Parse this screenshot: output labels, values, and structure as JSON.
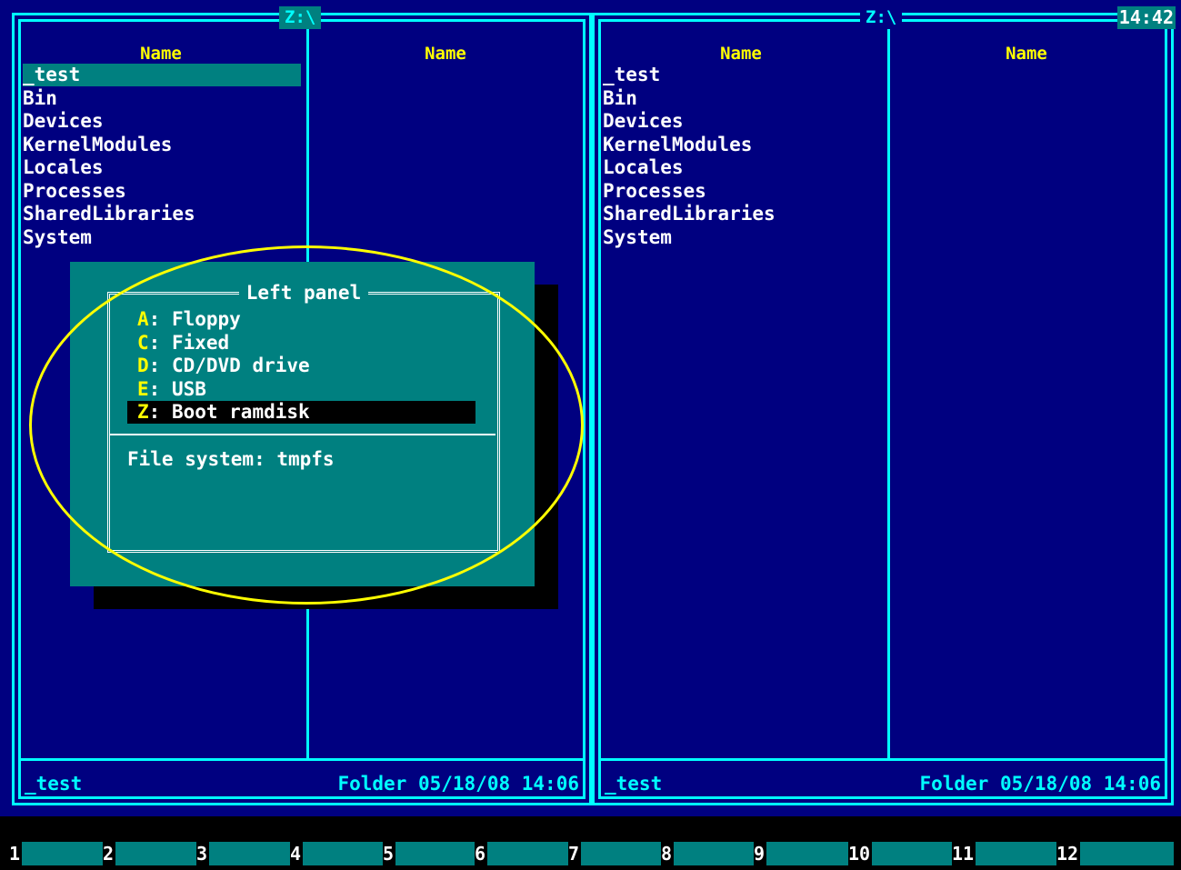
{
  "clock": "14:42",
  "left_panel": {
    "path": "Z:\\",
    "column_headers": [
      "Name",
      "Name"
    ],
    "items": [
      "_test",
      "Bin",
      "Devices",
      "KernelModules",
      "Locales",
      "Processes",
      "SharedLibraries",
      "System"
    ],
    "selected_index": 0,
    "status_name": "_test",
    "status_info": "Folder 05/18/08 14:06"
  },
  "right_panel": {
    "path": "Z:\\",
    "column_headers": [
      "Name",
      "Name"
    ],
    "items": [
      "_test",
      "Bin",
      "Devices",
      "KernelModules",
      "Locales",
      "Processes",
      "SharedLibraries",
      "System"
    ],
    "status_name": "_test",
    "status_info": "Folder 05/18/08 14:06"
  },
  "drive_dialog": {
    "title": "Left panel",
    "drives": [
      {
        "key": "A",
        "label": ": Floppy"
      },
      {
        "key": "C",
        "label": ": Fixed"
      },
      {
        "key": "D",
        "label": ": CD/DVD drive"
      },
      {
        "key": "E",
        "label": ": USB"
      },
      {
        "key": "Z",
        "label": ": Boot ramdisk"
      }
    ],
    "selected_index": 4,
    "info": "File system: tmpfs"
  },
  "function_keys": [
    "1",
    "2",
    "3",
    "4",
    "5",
    "6",
    "7",
    "8",
    "9",
    "10",
    "11",
    "12"
  ],
  "colors": {
    "background": "#000080",
    "frame": "#00ffff",
    "highlight": "#008080",
    "header_text": "#ffff00",
    "annotation": "#ffff00"
  }
}
